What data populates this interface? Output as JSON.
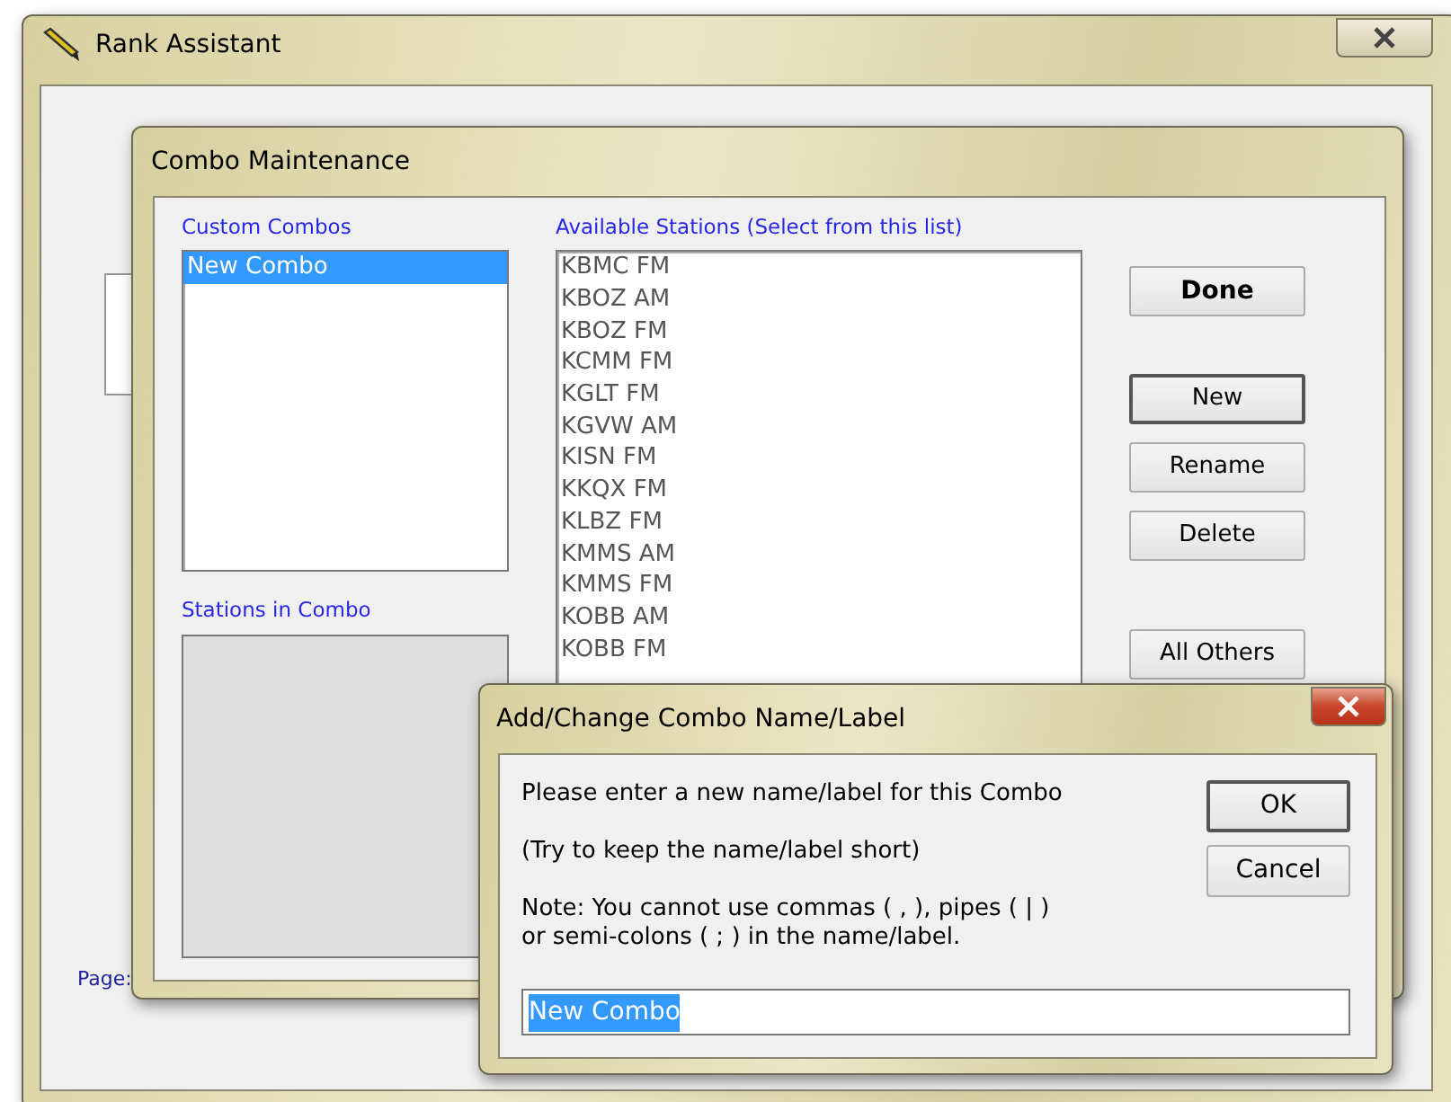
{
  "main_window": {
    "title": "Rank Assistant",
    "page_label": "Page:"
  },
  "combo_dialog": {
    "title": "Combo Maintenance",
    "custom_combos": {
      "label": "Custom Combos",
      "items": [
        {
          "text": "New Combo",
          "selected": true
        }
      ]
    },
    "stations_in_combo": {
      "label": "Stations in Combo",
      "disabled": true
    },
    "available_stations": {
      "label": "Available Stations (Select from this list)",
      "items": [
        {
          "text": "KBMC FM",
          "selected": false
        },
        {
          "text": "KBOZ AM",
          "selected": false
        },
        {
          "text": "KBOZ FM",
          "selected": false
        },
        {
          "text": "KCMM FM",
          "selected": false
        },
        {
          "text": "KGLT FM",
          "selected": false
        },
        {
          "text": "KGVW AM",
          "selected": false
        },
        {
          "text": "KISN FM",
          "selected": false
        },
        {
          "text": "KKQX FM",
          "selected": false
        },
        {
          "text": "KLBZ FM",
          "selected": false
        },
        {
          "text": "KMMS AM",
          "selected": false
        },
        {
          "text": "KMMS FM",
          "selected": false
        },
        {
          "text": "KOBB AM",
          "selected": false
        },
        {
          "text": "KOBB FM",
          "selected": false
        }
      ]
    },
    "buttons": [
      {
        "label": "Done",
        "default": true,
        "focused": false
      },
      {
        "label": "New",
        "default": false,
        "focused": true
      },
      {
        "label": "Rename",
        "default": false,
        "focused": false
      },
      {
        "label": "Delete",
        "default": false,
        "focused": false
      },
      {
        "label": "All Others",
        "default": false,
        "focused": false
      }
    ]
  },
  "name_dialog": {
    "title": "Add/Change Combo Name/Label",
    "lines": [
      "Please enter a new name/label for this Combo",
      "(Try to keep the name/label short)",
      "Note: You cannot use commas ( , ), pipes ( | ) or semi-colons ( ; ) in the name/label."
    ],
    "input": {
      "value": "New Combo",
      "selected": true
    },
    "buttons": [
      {
        "label": "OK",
        "focused": true
      },
      {
        "label": "Cancel",
        "focused": false
      }
    ]
  }
}
